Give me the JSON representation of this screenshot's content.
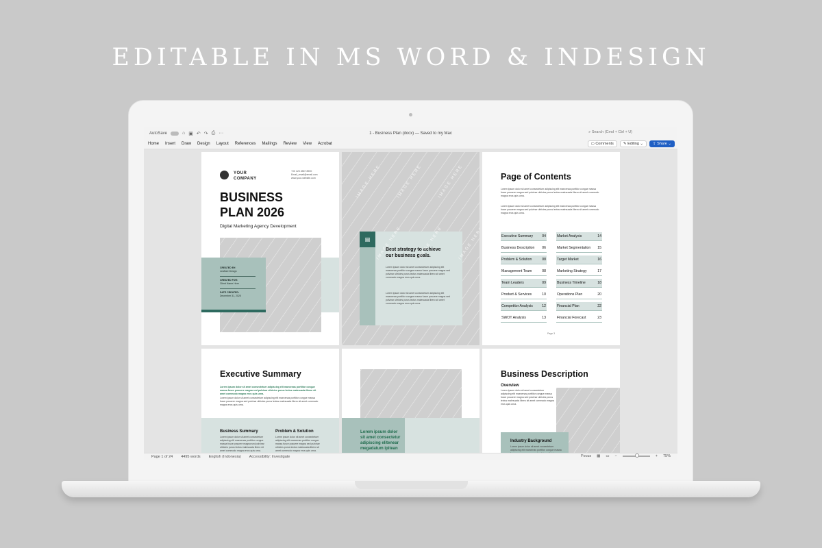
{
  "headline": "EDITABLE IN MS WORD & INDESIGN",
  "window": {
    "autosave": "AutoSave",
    "doc_title": "1 - Business Plan (docx) — Saved to my Mac",
    "search": "Search (Cmd + Ctrl + U)"
  },
  "ribbon": {
    "tabs": [
      "Home",
      "Insert",
      "Draw",
      "Design",
      "Layout",
      "References",
      "Mailings",
      "Review",
      "View",
      "Acrobat"
    ],
    "comments": "Comments",
    "editing": "Editing",
    "share": "Share"
  },
  "page1": {
    "logo_line1": "YOUR",
    "logo_line2": "COMPANY",
    "contact1": "+00 123 4567 8900",
    "contact2": "Email_email@email.com",
    "contact3": "www.your-website.com",
    "title1": "BUSINESS",
    "title2": "PLAN 2026",
    "subtitle": "Digital Marketing Agency Development",
    "created_by_label": "CREATED BY:",
    "created_by": "Leaflore Design",
    "created_for_label": "CREATED FOR:",
    "created_for": "Client Name Here",
    "date_label": "DATE CREATED:",
    "date": "December 31, 2025"
  },
  "page2": {
    "watermark": "IMAGE HERE",
    "heading1": "Best strategy to achieve",
    "heading2": "our business goals."
  },
  "page3": {
    "title": "Page of Contents",
    "page_label": "Page 3",
    "toc_left": [
      {
        "label": "Executive Summary",
        "page": "04"
      },
      {
        "label": "Business Description",
        "page": "06"
      },
      {
        "label": "Problem & Solution",
        "page": "08"
      },
      {
        "label": "Management Team",
        "page": "08"
      },
      {
        "label": "Team Leaders",
        "page": "09"
      },
      {
        "label": "Product & Services",
        "page": "10"
      },
      {
        "label": "Competitor Analysis",
        "page": "12"
      },
      {
        "label": "SWOT Analysis",
        "page": "13"
      }
    ],
    "toc_right": [
      {
        "label": "Market Analysis",
        "page": "14"
      },
      {
        "label": "Market Segmentation",
        "page": "15"
      },
      {
        "label": "Target Market",
        "page": "16"
      },
      {
        "label": "Marketing Strategy",
        "page": "17"
      },
      {
        "label": "Business Timeline",
        "page": "18"
      },
      {
        "label": "Operations Plan",
        "page": "20"
      },
      {
        "label": "Financial Plan",
        "page": "22"
      },
      {
        "label": "Financial Forecast",
        "page": "23"
      }
    ]
  },
  "page4": {
    "title": "Executive Summary",
    "lead": "Lorem ipsum dolor sit amet consectetuer adipiscing elit maecenas porttitor congue massa fusce posuere magna sed pulvinar ultricies purus lectus malesuada libero sit amet commodo magna eros quis urna.",
    "col1": "Business Summary",
    "col2": "Problem & Solution"
  },
  "page5": {
    "callout1": "Lorem ipsum dolor",
    "callout2": "sit amet consectetur",
    "callout3": "adipiscing elitenear",
    "callout4": "megadatum ipitean"
  },
  "page6": {
    "title": "Business Description",
    "subtitle": "Overview",
    "box": "Industry Background"
  },
  "body_text": "Lorem ipsum dolor sit amet consectetuer adipiscing elit maecenas porttitor congue massa fusce posuere magna sed pulvinar ultricies purus lectus malesuada libero sit amet commodo magna eros quis urna.",
  "status": {
    "page": "Page 1 of 24",
    "words": "4495 words",
    "language": "English (Indonesia)",
    "accessibility": "Accessibility: Investigate",
    "focus": "Focus",
    "zoom": "75%"
  }
}
